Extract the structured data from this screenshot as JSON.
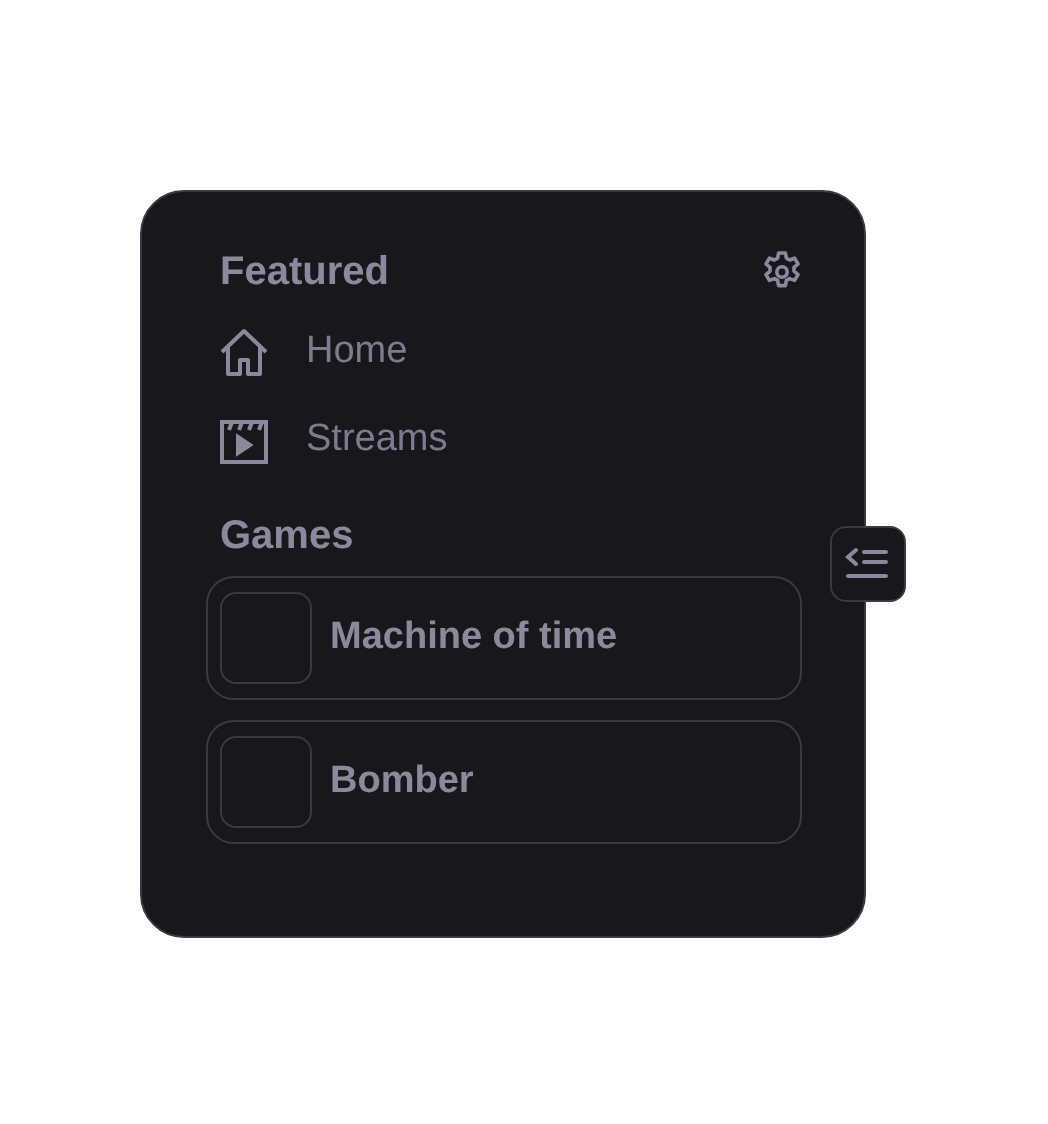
{
  "sections": [
    {
      "title": "Featured",
      "items": [
        {
          "kind": "home",
          "label": "Home"
        },
        {
          "kind": "streams",
          "label": "Streams"
        }
      ]
    },
    {
      "title": "Games",
      "games": [
        {
          "title": "Machine of time"
        },
        {
          "title": "Bomber"
        }
      ]
    }
  ]
}
